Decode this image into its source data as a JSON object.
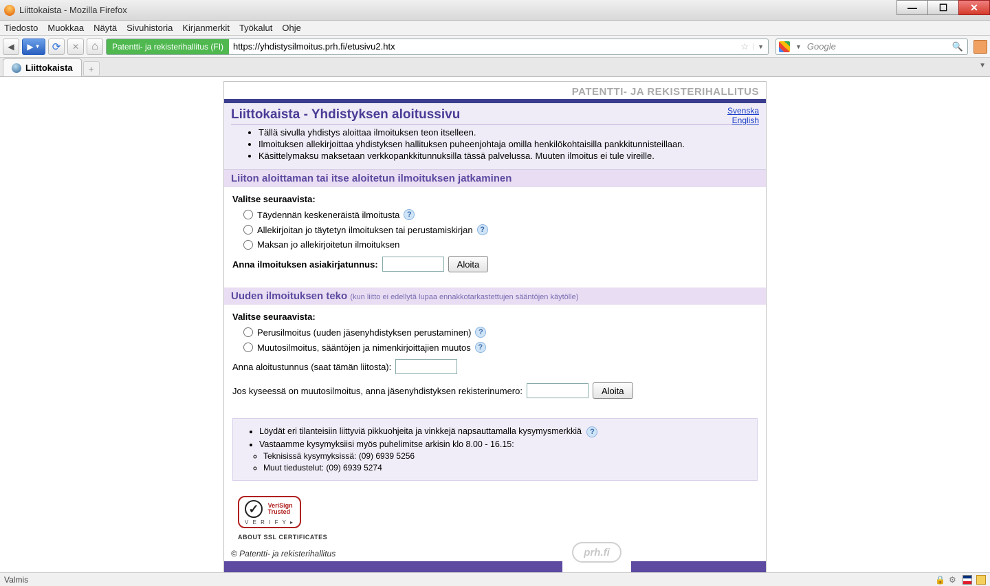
{
  "window": {
    "title": "Liittokaista - Mozilla Firefox"
  },
  "menu": {
    "file": "Tiedosto",
    "edit": "Muokkaa",
    "view": "Näytä",
    "history": "Sivuhistoria",
    "bookmarks": "Kirjanmerkit",
    "tools": "Työkalut",
    "help": "Ohje"
  },
  "toolbar": {
    "site_badge": "Patentti- ja rekisterihallitus (FI)",
    "url": "https://yhdistysilmoitus.prh.fi/etusivu2.htx",
    "search_placeholder": "Google"
  },
  "tabs": {
    "active": "Liittokaista"
  },
  "page": {
    "agency": "PATENTTI- JA REKISTERIHALLITUS",
    "title": "Liittokaista - Yhdistyksen aloitussivu",
    "lang1": "Svenska",
    "lang2": "English",
    "bullets": [
      "Tällä sivulla yhdistys aloittaa ilmoituksen teon itselleen.",
      "Ilmoituksen allekirjoittaa yhdistyksen hallituksen puheenjohtaja omilla henkilökohtaisilla pankkitunnisteillaan.",
      "Käsittelymaksu maksetaan verkkopankkitunnuksilla tässä palvelussa. Muuten ilmoitus ei tule vireille."
    ],
    "sec1": {
      "head": "Liiton aloittaman tai itse aloitetun ilmoituksen jatkaminen",
      "prompt": "Valitse seuraavista:",
      "r1": "Täydennän keskeneräistä ilmoitusta",
      "r2": "Allekirjoitan jo täytetyn ilmoituksen tai perustamiskirjan",
      "r3": "Maksan jo allekirjoitetun ilmoituksen",
      "label": "Anna ilmoituksen asiakirjatunnus:",
      "btn": "Aloita"
    },
    "sec2": {
      "head": "Uuden ilmoituksen teko",
      "sub": "(kun liitto ei edellytä lupaa ennakkotarkastettujen sääntöjen käytölle)",
      "prompt": "Valitse seuraavista:",
      "r1": "Perusilmoitus (uuden jäsenyhdistyksen perustaminen)",
      "r2": "Muutosilmoitus, sääntöjen ja nimenkirjoittajien muutos",
      "label1": "Anna aloitustunnus (saat tämän liitosta):",
      "label2": "Jos kyseessä on muutosilmoitus, anna jäsenyhdistyksen rekisterinumero:",
      "btn": "Aloita"
    },
    "info": {
      "l1": "Löydät eri tilanteisiin liittyviä pikkuohjeita ja vinkkejä napsauttamalla kysymysmerkkiä",
      "l2": "Vastaamme kysymyksiisi myös puhelimitse arkisin klo 8.00 - 16.15:",
      "l2a": "Teknisissä kysymyksissä: (09) 6939 5256",
      "l2b": "Muut tiedustelut: (09) 6939 5274"
    },
    "verisign": {
      "brand1": "VeriSign",
      "brand2": "Trusted",
      "verify": "V E R I F Y ▸",
      "about": "ABOUT SSL CERTIFICATES"
    },
    "copyright": "© Patentti- ja rekisterihallitus",
    "prh": "prh.fi"
  },
  "status": {
    "text": "Valmis"
  }
}
